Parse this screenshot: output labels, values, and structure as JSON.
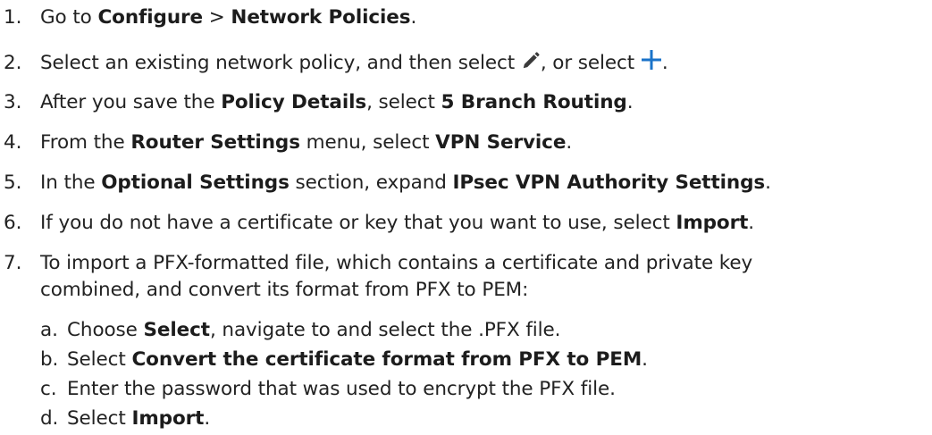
{
  "steps": [
    {
      "num": "1.",
      "t1": "Go to ",
      "b1": "Configure",
      "t2": " > ",
      "b2": "Network Policies",
      "t3": "."
    },
    {
      "num": "2.",
      "t1": "Select an existing network policy, and then select ",
      "icon1": "pencil-icon",
      "t2": ", or select ",
      "icon2": "plus-icon",
      "t3": "."
    },
    {
      "num": "3.",
      "t1": "After you save the ",
      "b1": "Policy Details",
      "t2": ", select ",
      "b2": "5 Branch Routing",
      "t3": "."
    },
    {
      "num": "4.",
      "t1": "From the ",
      "b1": "Router Settings",
      "t2": " menu, select ",
      "b2": "VPN Service",
      "t3": "."
    },
    {
      "num": "5.",
      "t1": "In the ",
      "b1": "Optional Settings",
      "t2": " section, expand ",
      "b2": "IPsec VPN Authority Settings",
      "t3": "."
    },
    {
      "num": "6.",
      "t1": "If you do not have a certificate or key that you want to use, select ",
      "b1": "Import",
      "t2": "."
    },
    {
      "num": "7.",
      "line1": "To import a PFX-formatted file, which contains a certificate and private key",
      "line2": "combined, and convert its format from PFX to PEM:"
    }
  ],
  "substeps": [
    {
      "num": "a.",
      "t1": "Choose ",
      "b1": "Select",
      "t2": ", navigate to and select the .PFX file."
    },
    {
      "num": "b.",
      "t1": "Select ",
      "b1": "Convert the certificate format from PFX to PEM",
      "t2": "."
    },
    {
      "num": "c.",
      "t1": "Enter the password that was used to encrypt the PFX file."
    },
    {
      "num": "d.",
      "t1": "Select ",
      "b1": "Import",
      "t2": "."
    }
  ],
  "colors": {
    "text": "#222222",
    "pencil": "#3a3a3a",
    "plus": "#1a73c9"
  }
}
